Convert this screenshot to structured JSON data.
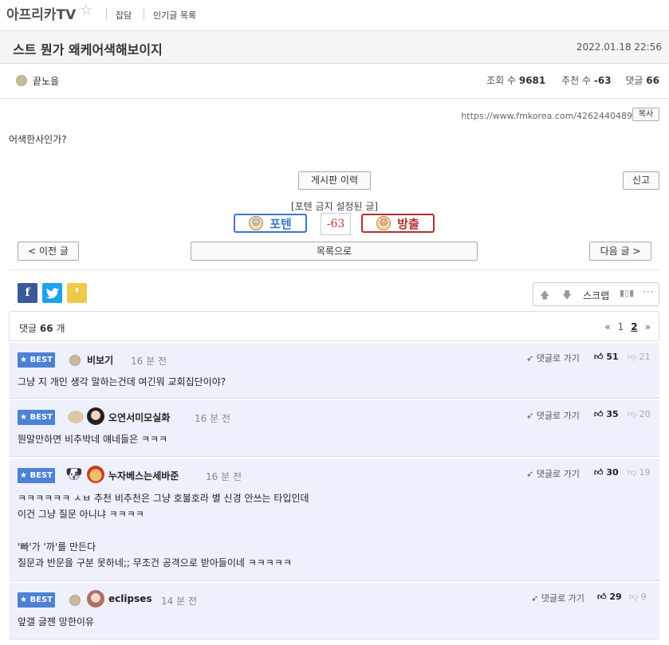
{
  "site": {
    "logo": "아프리카TV",
    "star_icon": "star-outline-icon",
    "links": [
      "잡담",
      "인기글 목록"
    ]
  },
  "post": {
    "title": "스트 뭔가 왜케어색해보이지",
    "date": "2022.01.18 22:56",
    "author": "끝노을",
    "views_label": "조회 수",
    "views": "9681",
    "votes_label": "추천 수",
    "votes": "-63",
    "comments_label": "댓글",
    "comments": "66",
    "url": "https://www.fmkorea.com/4262440489",
    "copy_label": "복사",
    "body": "어색한사인가?"
  },
  "actions": {
    "history": "게시판 이력",
    "report": "신고",
    "poten_notice": "[포텐 금지 설정된 글]",
    "poten": "포텐",
    "score": "-63",
    "banish": "방출",
    "prev": "< 이전 글",
    "list": "목록으로",
    "next": "다음 글 >"
  },
  "toolbar": {
    "scrap": "스크랩"
  },
  "comments_header": {
    "prefix": "댓글",
    "count": "66",
    "suffix": "개",
    "pages": [
      "«",
      "1",
      "2",
      "»"
    ],
    "current_page": "2"
  },
  "best_label": "BEST",
  "goto_label": "댓글로 가기",
  "comment_list": [
    {
      "nick": "비보기",
      "time": "16 분 전",
      "up": "51",
      "down": "21",
      "lines": [
        "그냥 지 개인 생각 말하는건데 여긴뭐 교회집단이야?"
      ]
    },
    {
      "nick": "오연서미모실화",
      "time": "16 분 전",
      "up": "35",
      "down": "20",
      "lines": [
        "뭔말만하면 비추박네 얘네들은 ㅋㅋㅋ"
      ]
    },
    {
      "nick": "누자베스는세바준",
      "time": "16 분 전",
      "up": "30",
      "down": "19",
      "lines": [
        "ㅋㅋㅋㅋㅋㅋ ㅅㅂ 추천 비추천은 그냥 호불호라 별 신경 안쓰는 타입인데",
        "이건 그냥 질문 아니냐 ㅋㅋㅋㅋ",
        "",
        "'빠'가 '까'를 만든다",
        "질문과 반문을 구분 못하네;; 무조건 공격으로 받아들이네 ㅋㅋㅋㅋㅋ"
      ]
    },
    {
      "nick": "eclipses",
      "time": "14 분 전",
      "up": "29",
      "down": "9",
      "lines": [
        "앞갤 글젠 망한이유"
      ]
    }
  ]
}
